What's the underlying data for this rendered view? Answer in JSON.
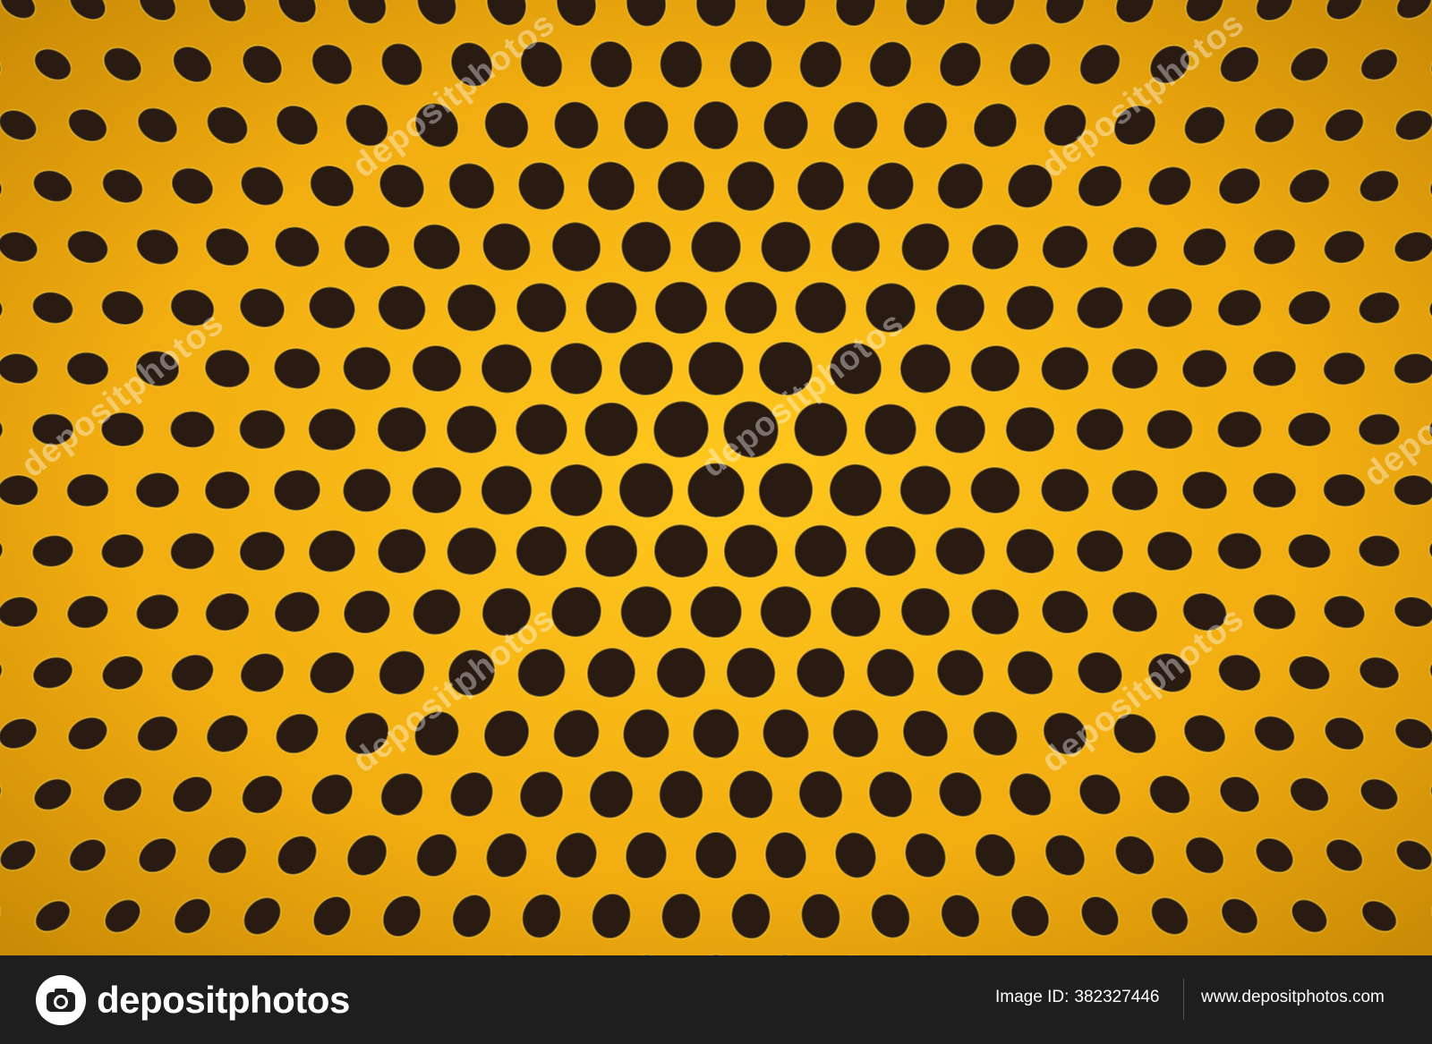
{
  "photo": {
    "subject": "honeycomb-mesh",
    "colors": {
      "mesh": "#f2b214",
      "mesh_highlight": "#ffd84a",
      "mesh_shadow": "#b07a08",
      "holes": "#2a1b12"
    }
  },
  "watermark": {
    "text": "depositphotos"
  },
  "footer": {
    "brand_name": "depositphotos",
    "image_id_label": "Image ID:",
    "image_id_value": "382327446",
    "site_url": "www.depositphotos.com",
    "background": "#1e1e1e",
    "text_color": "#ffffff"
  }
}
